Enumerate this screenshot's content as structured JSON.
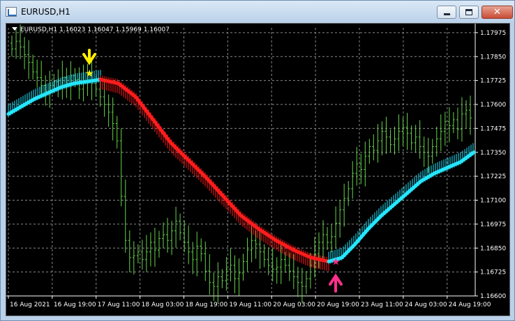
{
  "window": {
    "title": "EURUSD,H1",
    "buttons": [
      "minimize",
      "maximize",
      "close"
    ]
  },
  "chart_info": {
    "symbol": "EURUSD,H1",
    "open": "1.16023",
    "high": "1.16047",
    "low": "1.15969",
    "close": "1.16007"
  },
  "colors": {
    "background": "#000000",
    "grid": "#8a8a8a",
    "candles": "#66d24c",
    "bull_trend": "#25e6ff",
    "bear_trend": "#ff1c1c",
    "sell_arrow": "#ffee00",
    "buy_arrow": "#ff2f8c"
  },
  "chart_data": {
    "type": "line",
    "price_ticks": [
      "1.17975",
      "1.17850",
      "1.17725",
      "1.17600",
      "1.17475",
      "1.17350",
      "1.17225",
      "1.17100",
      "1.16975",
      "1.16850",
      "1.16725",
      "1.16600"
    ],
    "time_ticks": [
      "16 Aug 2021",
      "16 Aug 19:00",
      "17 Aug 11:00",
      "18 Aug 03:00",
      "18 Aug 19:00",
      "19 Aug 11:00",
      "20 Aug 03:00",
      "20 Aug 19:00",
      "23 Aug 11:00",
      "24 Aug 03:00",
      "24 Aug 19:00"
    ],
    "ylim": [
      1.166,
      1.18
    ],
    "price_closes": [
      1.1789,
      1.1793,
      1.179,
      1.1786,
      1.1782,
      1.1777,
      1.1774,
      1.177,
      1.1767,
      1.177,
      1.1772,
      1.1769,
      1.1774,
      1.1771,
      1.1775,
      1.1773,
      1.1768,
      1.1772,
      1.1776,
      1.1771,
      1.1768,
      1.1764,
      1.176,
      1.1756,
      1.175,
      1.1741,
      1.1712,
      1.1689,
      1.168,
      1.1681,
      1.1683,
      1.1679,
      1.1683,
      1.1688,
      1.1684,
      1.169,
      1.1692,
      1.1689,
      1.1694,
      1.1699,
      1.1693,
      1.1688,
      1.1683,
      1.1679,
      1.1686,
      1.1682,
      1.1673,
      1.1667,
      1.1665,
      1.167,
      1.1668,
      1.1674,
      1.1676,
      1.1669,
      1.1672,
      1.1678,
      1.1684,
      1.1689,
      1.1687,
      1.1683,
      1.1679,
      1.1676,
      1.1674,
      1.1675,
      1.1679,
      1.1676,
      1.1673,
      1.167,
      1.1667,
      1.1665,
      1.1669,
      1.1676,
      1.1682,
      1.1688,
      1.1692,
      1.1688,
      1.1691,
      1.1698,
      1.1705,
      1.1711,
      1.1716,
      1.1724,
      1.1729,
      1.1726,
      1.1733,
      1.1738,
      1.1736,
      1.1741,
      1.1746,
      1.1743,
      1.1739,
      1.1742,
      1.1746,
      1.1748,
      1.1745,
      1.174,
      1.1743,
      1.1738,
      1.1735,
      1.1733,
      1.1738,
      1.1742,
      1.1746,
      1.1751,
      1.1749,
      1.1752,
      1.1747,
      1.1755,
      1.1757,
      1.1753
    ],
    "series": [
      {
        "name": "",
        "trend": "bull",
        "values": [
          1.1755,
          1.1759,
          1.1763,
          1.1766,
          1.1769,
          1.1771,
          1.1772,
          1.1773
        ]
      },
      {
        "name": "",
        "trend": "bear",
        "values": [
          1.1773,
          1.1771,
          1.1764,
          1.1752,
          1.174,
          1.1731,
          1.1722,
          1.1712,
          1.1702,
          1.1695,
          1.1689,
          1.1684,
          1.168,
          1.1678
        ]
      },
      {
        "name": "",
        "trend": "bull",
        "values": [
          1.1678,
          1.168,
          1.1687,
          1.1695,
          1.1702,
          1.1708,
          1.1714,
          1.172,
          1.1724,
          1.1727,
          1.173,
          1.1735
        ]
      }
    ],
    "signals": [
      {
        "type": "sell",
        "time": "17 Aug",
        "price": 1.1776
      },
      {
        "type": "buy",
        "time": "20 Aug",
        "price": 1.1677
      }
    ]
  }
}
